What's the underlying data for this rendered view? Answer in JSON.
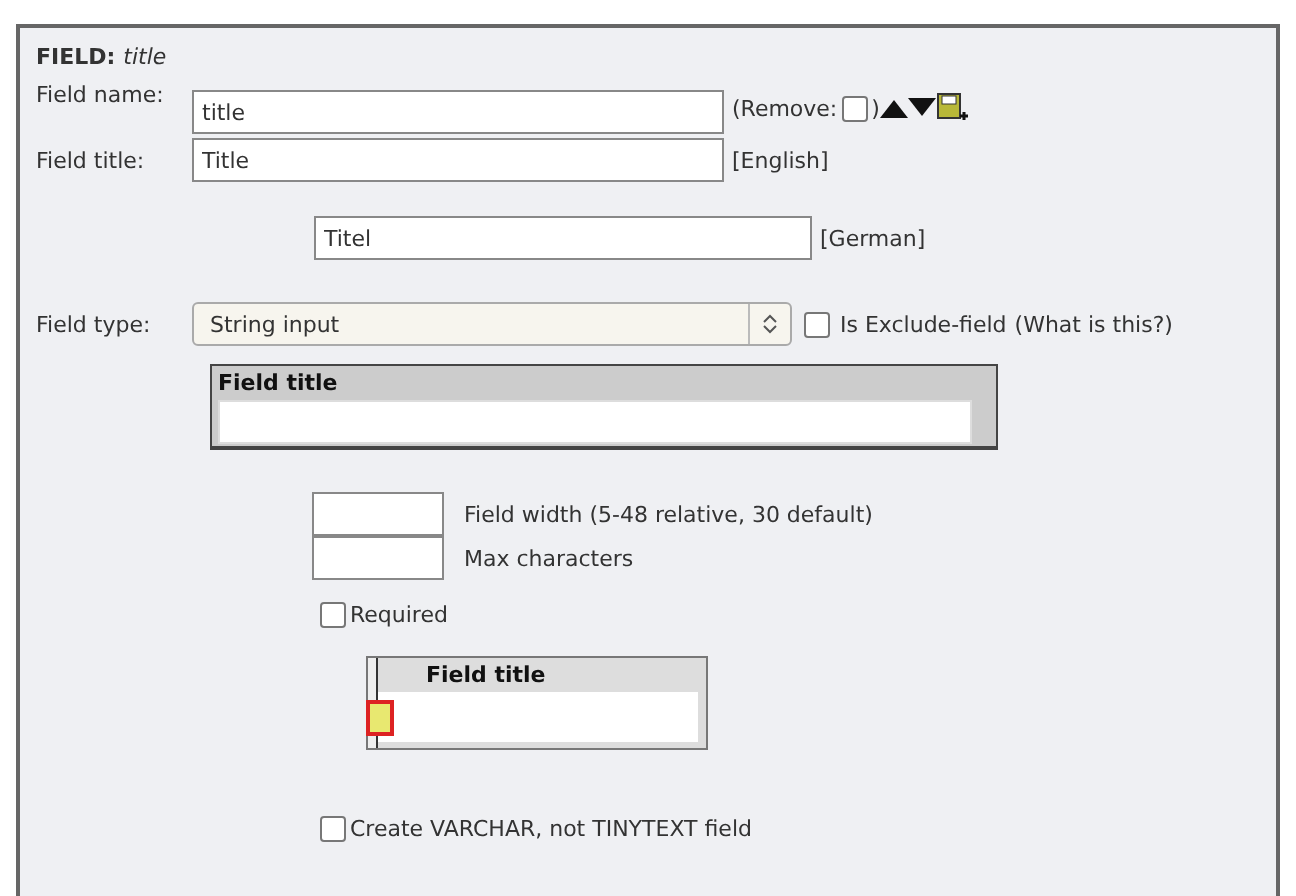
{
  "heading": {
    "label": "FIELD:",
    "name": "title"
  },
  "field_name": {
    "label": "Field name:",
    "value": "title",
    "remove_open": "(Remove:",
    "remove_checked": false,
    "remove_close": ")"
  },
  "field_titles": [
    {
      "label": "Field title:",
      "value": "Title",
      "language": "[English]"
    },
    {
      "value": "Titel",
      "language": "[German]"
    }
  ],
  "field_type": {
    "label": "Field type:",
    "value": "String input",
    "exclude_checked": false,
    "exclude_label": "Is Exclude-field",
    "help_link": "(What is this?)"
  },
  "preview": {
    "header": "Field title"
  },
  "sizes": [
    {
      "label": "Field width (5-48 relative, 30 default)"
    },
    {
      "label": "Max characters"
    }
  ],
  "required": {
    "label": "Required",
    "checked": false
  },
  "preview_small": {
    "header": "Field title"
  },
  "varchar": {
    "label": "Create VARCHAR, not TINYTEXT field",
    "checked": false
  }
}
